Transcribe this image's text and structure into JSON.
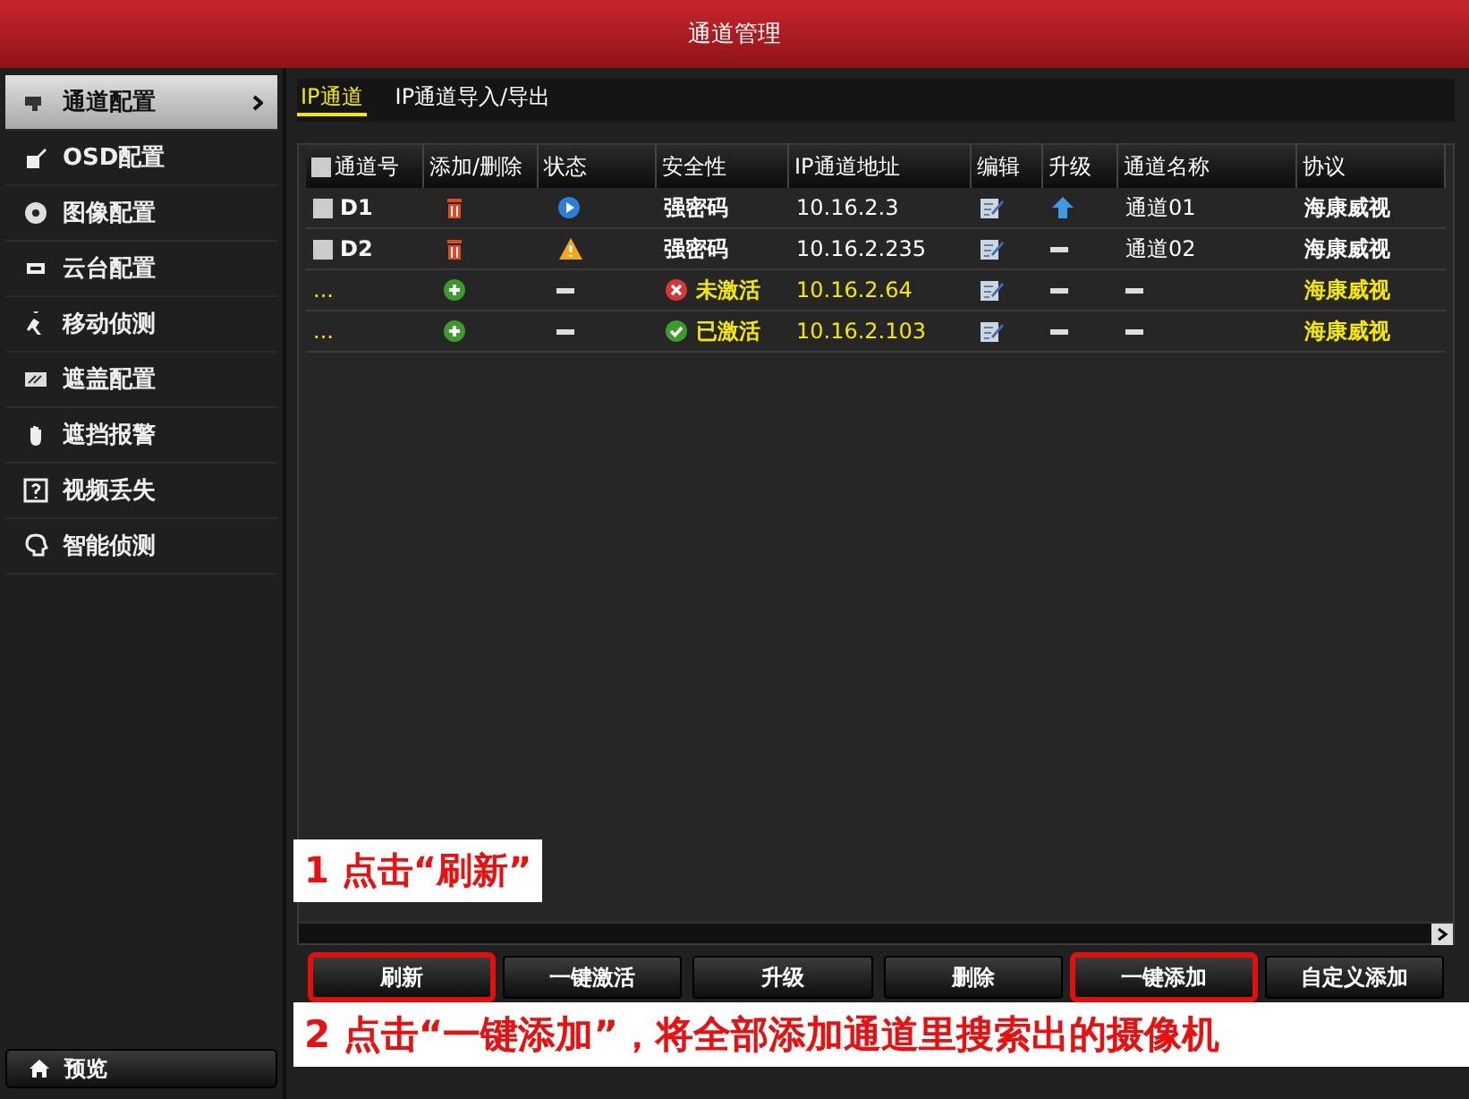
{
  "window": {
    "title": "通道管理"
  },
  "sidebar": {
    "items": [
      {
        "label": "通道配置",
        "selected": true
      },
      {
        "label": "OSD配置",
        "selected": false
      },
      {
        "label": "图像配置",
        "selected": false
      },
      {
        "label": "云台配置",
        "selected": false
      },
      {
        "label": "移动侦测",
        "selected": false
      },
      {
        "label": "遮盖配置",
        "selected": false
      },
      {
        "label": "遮挡报警",
        "selected": false
      },
      {
        "label": "视频丢失",
        "selected": false
      },
      {
        "label": "智能侦测",
        "selected": false
      }
    ],
    "bottom_button": "预览"
  },
  "tabs": [
    {
      "label": "IP通道",
      "selected": true
    },
    {
      "label": "IP通道导入/导出",
      "selected": false
    }
  ],
  "table": {
    "select_all_checked": false,
    "columns": [
      "通道号",
      "添加/删除",
      "状态",
      "安全性",
      "IP通道地址",
      "编辑",
      "升级",
      "通道名称",
      "协议"
    ],
    "rows": [
      {
        "kind": "added",
        "checked": false,
        "cells": [
          {
            "kind": "text",
            "text": "D1"
          },
          {
            "kind": "delete"
          },
          {
            "kind": "play"
          },
          {
            "kind": "text",
            "text": "强密码"
          },
          {
            "kind": "text",
            "text": "10.16.2.3"
          },
          {
            "kind": "edit"
          },
          {
            "kind": "up"
          },
          {
            "kind": "text",
            "text": "通道01"
          },
          {
            "kind": "text",
            "text": "海康威视"
          }
        ]
      },
      {
        "kind": "added",
        "checked": false,
        "cells": [
          {
            "kind": "text",
            "text": "D2"
          },
          {
            "kind": "delete"
          },
          {
            "kind": "warning"
          },
          {
            "kind": "text",
            "text": "强密码"
          },
          {
            "kind": "text",
            "text": "10.16.2.235"
          },
          {
            "kind": "edit"
          },
          {
            "kind": "dash"
          },
          {
            "kind": "text",
            "text": "通道02"
          },
          {
            "kind": "text",
            "text": "海康威视"
          }
        ]
      },
      {
        "kind": "found",
        "cells": [
          {
            "kind": "text",
            "text": "..."
          },
          {
            "kind": "add"
          },
          {
            "kind": "dash"
          },
          {
            "kind": "error",
            "text": "未激活"
          },
          {
            "kind": "text",
            "text": "10.16.2.64"
          },
          {
            "kind": "edit"
          },
          {
            "kind": "dash"
          },
          {
            "kind": "dash"
          },
          {
            "kind": "text",
            "text": "海康威视"
          }
        ]
      },
      {
        "kind": "found",
        "cells": [
          {
            "kind": "text",
            "text": "..."
          },
          {
            "kind": "add"
          },
          {
            "kind": "dash"
          },
          {
            "kind": "ok",
            "text": "已激活"
          },
          {
            "kind": "text",
            "text": "10.16.2.103"
          },
          {
            "kind": "edit"
          },
          {
            "kind": "dash"
          },
          {
            "kind": "dash"
          },
          {
            "kind": "text",
            "text": "海康威视"
          }
        ]
      }
    ]
  },
  "buttons": [
    {
      "label": "刷新",
      "highlighted": true
    },
    {
      "label": "一键激活",
      "highlighted": false
    },
    {
      "label": "升级",
      "highlighted": false
    },
    {
      "label": "删除",
      "highlighted": false
    },
    {
      "label": "一键添加",
      "highlighted": true
    },
    {
      "label": "自定义添加",
      "highlighted": false
    }
  ],
  "annotations": [
    {
      "text": "1 点击“刷新”"
    },
    {
      "text": "2 点击“一键添加”，将全部添加通道里搜索出的摄像机"
    }
  ]
}
